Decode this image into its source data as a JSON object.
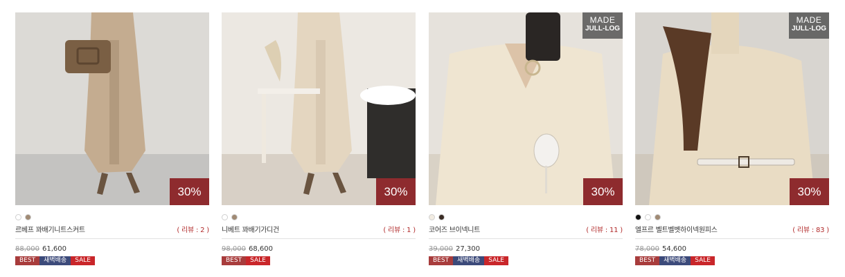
{
  "products": [
    {
      "name": "르베프 꽈배기니트스커트",
      "review": "( 리뷰 : 2 )",
      "original_price": "88,000",
      "sale_price": "61,600",
      "discount": "30%",
      "made_badge": null,
      "swatches": [
        "#ffffff",
        "#a08a74"
      ],
      "badges": [
        "BEST",
        "새벽배송",
        "SALE"
      ],
      "image_colors": {
        "bg": "#dcdad6",
        "floor": "#c4c3c1",
        "dress": "#c4ac90",
        "accent": "#7b6248"
      }
    },
    {
      "name": "니베트 꽈배기가디건",
      "review": "( 리뷰 : 1 )",
      "original_price": "98,000",
      "sale_price": "68,600",
      "discount": "30%",
      "made_badge": null,
      "swatches": [
        "#ffffff",
        "#a08a74"
      ],
      "badges": [
        "BEST",
        "SALE"
      ],
      "image_colors": {
        "bg": "#ece8e2",
        "floor": "#d8d0c6",
        "dress": "#e4d6c0",
        "accent": "#b7a387"
      }
    },
    {
      "name": "코어즈 브이넥니트",
      "review": "( 리뷰 : 11 )",
      "original_price": "39,000",
      "sale_price": "27,300",
      "discount": "30%",
      "made_badge": {
        "line1": "MADE",
        "line2": "JULL-LOG"
      },
      "swatches": [
        "#f2ece2",
        "#3a2c24"
      ],
      "badges": [
        "BEST",
        "새벽배송",
        "SALE"
      ],
      "image_colors": {
        "bg": "#e6e2dc",
        "floor": "#d9d2c6",
        "dress": "#efe5d1",
        "accent": "#c8b68f"
      }
    },
    {
      "name": "엘프르 벨트벨벳하이넥원피스",
      "review": "( 리뷰 : 83 )",
      "original_price": "78,000",
      "sale_price": "54,600",
      "discount": "30%",
      "made_badge": {
        "line1": "MADE",
        "line2": "JULL-LOG"
      },
      "swatches": [
        "#111111",
        "#ffffff",
        "#a08a74"
      ],
      "badges": [
        "BEST",
        "새벽배송",
        "SALE"
      ],
      "image_colors": {
        "bg": "#d8d5d0",
        "floor": "#cfc8bd",
        "dress": "#e9dcc4",
        "accent": "#5a3a26"
      }
    }
  ]
}
